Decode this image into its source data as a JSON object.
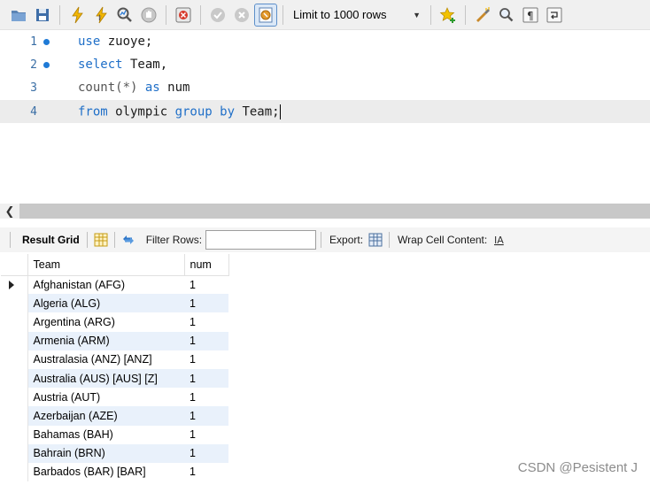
{
  "toolbar": {
    "limit_label": "Limit to 1000 rows",
    "icons": [
      "folder-open-icon",
      "save-icon",
      "execute-icon",
      "execute-current-icon",
      "explain-icon",
      "stop-icon",
      "toggle-errors-icon",
      "commit-icon",
      "rollback-icon",
      "autocommit-icon",
      "beautify-icon",
      "find-icon",
      "invisible-chars-icon",
      "wrap-icon"
    ]
  },
  "editor": {
    "lines": [
      {
        "num": "1",
        "has_dot": true
      },
      {
        "num": "2",
        "has_dot": true
      },
      {
        "num": "3",
        "has_dot": false
      },
      {
        "num": "4",
        "has_dot": false
      }
    ],
    "code": {
      "l1_kw": "use",
      "l1_rest": " zuoye;",
      "l2_kw": "select",
      "l2_rest": " Team,",
      "l3_fn": "count(*)",
      "l3_kw": " as",
      "l3_rest": " num",
      "l4_kw1": "from",
      "l4_mid": " olympic ",
      "l4_kw2": "group by",
      "l4_rest": " Team;"
    }
  },
  "results_toolbar": {
    "result_grid": "Result Grid",
    "filter_rows": "Filter Rows:",
    "filter_value": "",
    "export": "Export:",
    "wrap_cell": "Wrap Cell Content:"
  },
  "grid": {
    "columns": [
      "Team",
      "num"
    ],
    "rows": [
      [
        "Afghanistan (AFG)",
        "1"
      ],
      [
        "Algeria (ALG)",
        "1"
      ],
      [
        "Argentina (ARG)",
        "1"
      ],
      [
        "Armenia (ARM)",
        "1"
      ],
      [
        "Australasia (ANZ) [ANZ]",
        "1"
      ],
      [
        "Australia (AUS) [AUS] [Z]",
        "1"
      ],
      [
        "Austria (AUT)",
        "1"
      ],
      [
        "Azerbaijan (AZE)",
        "1"
      ],
      [
        "Bahamas (BAH)",
        "1"
      ],
      [
        "Bahrain (BRN)",
        "1"
      ],
      [
        "Barbados (BAR) [BAR]",
        "1"
      ]
    ]
  },
  "watermark": "CSDN @Pesistent J",
  "colors": {
    "keyword": "#1f6fc8",
    "line_number": "#3a6ea5",
    "alt_row": "#e9f1fb"
  }
}
